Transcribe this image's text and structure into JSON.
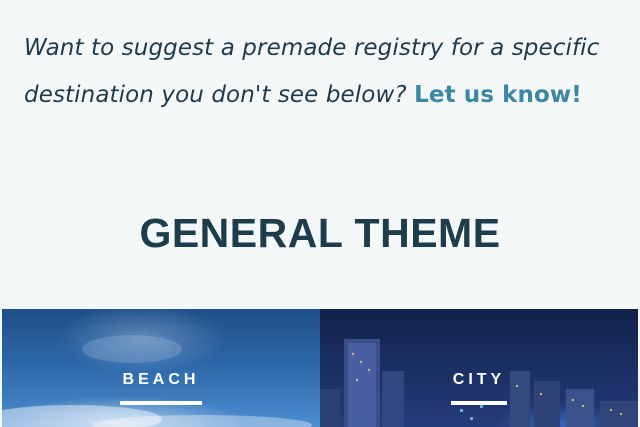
{
  "intro": {
    "text": "Want to suggest a premade registry for a specific destination you don't see below?",
    "link_label": "Let us know!"
  },
  "section": {
    "title": "GENERAL THEME"
  },
  "tiles": [
    {
      "label": "BEACH"
    },
    {
      "label": "CITY"
    }
  ],
  "colors": {
    "background": "#f4f8f9",
    "heading": "#1d3d4d",
    "link": "#3b87a4"
  }
}
